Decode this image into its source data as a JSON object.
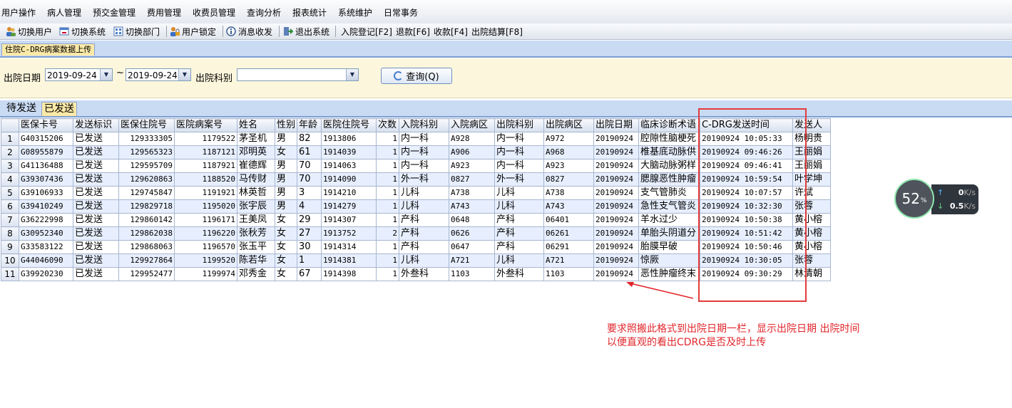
{
  "menu": [
    "用户操作",
    "病人管理",
    "预交金管理",
    "费用管理",
    "收费员管理",
    "查询分析",
    "报表统计",
    "系统维护",
    "日常事务"
  ],
  "toolbar": {
    "switch_user": "切换用户",
    "switch_system": "切换系统",
    "switch_dept": "切换部门",
    "user_lock": "用户锁定",
    "message": "消息收发",
    "exit": "退出系统",
    "admission": "入院登记[F2]",
    "refund": "退款[F6]",
    "payment": "收款[F4]",
    "discharge_settle": "出院结算[F8]"
  },
  "doc_tab": "住院C-DRG病案数据上传",
  "filter": {
    "date_label": "出院日期",
    "date_from": "2019-09-24",
    "tilde": "~",
    "date_to": "2019-09-24",
    "dept_label": "出院科别",
    "dept_value": "",
    "query_button": "查询(Q)"
  },
  "subtabs": [
    "待发送",
    "已发送"
  ],
  "columns": [
    "",
    "医保卡号",
    "发送标识",
    "医保住院号",
    "医院病案号",
    "姓名",
    "性别",
    "年龄",
    "医院住院号",
    "次数",
    "入院科别",
    "入院病区",
    "出院科别",
    "出院病区",
    "出院日期",
    "临床诊断术语",
    "C-DRG发送时间",
    "发送人"
  ],
  "rows": [
    [
      "1",
      "G40315206",
      "已发送",
      "129333305",
      "1179522",
      "茅圣机",
      "男",
      "82",
      "1913806",
      "1",
      "内一科",
      "A928",
      "内一科",
      "A972",
      "20190924",
      "腔隙性脑梗死",
      "20190924 10:05:33",
      "杨明贵"
    ],
    [
      "2",
      "G08955879",
      "已发送",
      "129565323",
      "1187121",
      "邓明英",
      "女",
      "61",
      "1914039",
      "1",
      "内一科",
      "A906",
      "内一科",
      "A968",
      "20190924",
      "椎基底动脉供",
      "20190924 09:46:26",
      "王丽娟"
    ],
    [
      "3",
      "G41136488",
      "已发送",
      "129595709",
      "1187921",
      "崔德辉",
      "男",
      "70",
      "1914063",
      "1",
      "内一科",
      "A923",
      "内一科",
      "A923",
      "20190924",
      "大脑动脉粥样",
      "20190924 09:46:41",
      "王丽娟"
    ],
    [
      "4",
      "G39307436",
      "已发送",
      "129620863",
      "1188520",
      "马传财",
      "男",
      "70",
      "1914090",
      "1",
      "外一科",
      "0827",
      "外一科",
      "0827",
      "20190924",
      "腮腺恶性肿瘤",
      "20190924 10:59:54",
      "叶学坤"
    ],
    [
      "5",
      "G39106933",
      "已发送",
      "129745847",
      "1191921",
      "林英哲",
      "男",
      "3",
      "1914210",
      "1",
      "儿科",
      "A738",
      "儿科",
      "A738",
      "20190924",
      "支气管肺炎",
      "20190924 10:07:57",
      "许斌"
    ],
    [
      "6",
      "G39410249",
      "已发送",
      "129829718",
      "1195020",
      "张宇辰",
      "男",
      "4",
      "1914279",
      "1",
      "儿科",
      "A743",
      "儿科",
      "A743",
      "20190924",
      "急性支气管炎",
      "20190924 10:32:30",
      "张蓉"
    ],
    [
      "7",
      "G36222998",
      "已发送",
      "129860142",
      "1196171",
      "王美凤",
      "女",
      "29",
      "1914307",
      "1",
      "产科",
      "0648",
      "产科",
      "06401",
      "20190924",
      "羊水过少",
      "20190924 10:50:38",
      "黄小榕"
    ],
    [
      "8",
      "G30952340",
      "已发送",
      "129862038",
      "1196220",
      "张秋芳",
      "女",
      "27",
      "1913752",
      "2",
      "产科",
      "0626",
      "产科",
      "06261",
      "20190924",
      "单胎头阴道分",
      "20190924 10:51:42",
      "黄小榕"
    ],
    [
      "9",
      "G33583122",
      "已发送",
      "129868063",
      "1196570",
      "张玉平",
      "女",
      "30",
      "1914314",
      "1",
      "产科",
      "0647",
      "产科",
      "06291",
      "20190924",
      "胎膜早破",
      "20190924 10:50:46",
      "黄小榕"
    ],
    [
      "10",
      "G44046090",
      "已发送",
      "129927864",
      "1199520",
      "陈若华",
      "女",
      "1",
      "1914381",
      "1",
      "儿科",
      "A721",
      "儿科",
      "A721",
      "20190924",
      "惊厥",
      "20190924 10:30:05",
      "张蓉"
    ],
    [
      "11",
      "G39920230",
      "已发送",
      "129952477",
      "1199974",
      "邓秀金",
      "女",
      "67",
      "1914398",
      "1",
      "外叁科",
      "1103",
      "外叁科",
      "1103",
      "20190924",
      "恶性肿瘤终末",
      "20190924 09:30:29",
      "林清朝"
    ]
  ],
  "annotation": {
    "line1": "要求照搬此格式到出院日期一栏，显示出院日期 出院时间",
    "line2": "以便直观的看出CDRG是否及时上传",
    "color": "#e0262b"
  },
  "net_widget": {
    "percent": "52",
    "percent_unit": "%",
    "up_rate": "0",
    "down_rate": "0.5",
    "rate_unit": "K/s"
  },
  "colors": {
    "accent_tab": "#fbe9a8",
    "tab_bar": "#c9daf3",
    "filter_bg": "#fcf7dc",
    "alt_row": "#e7efff"
  }
}
